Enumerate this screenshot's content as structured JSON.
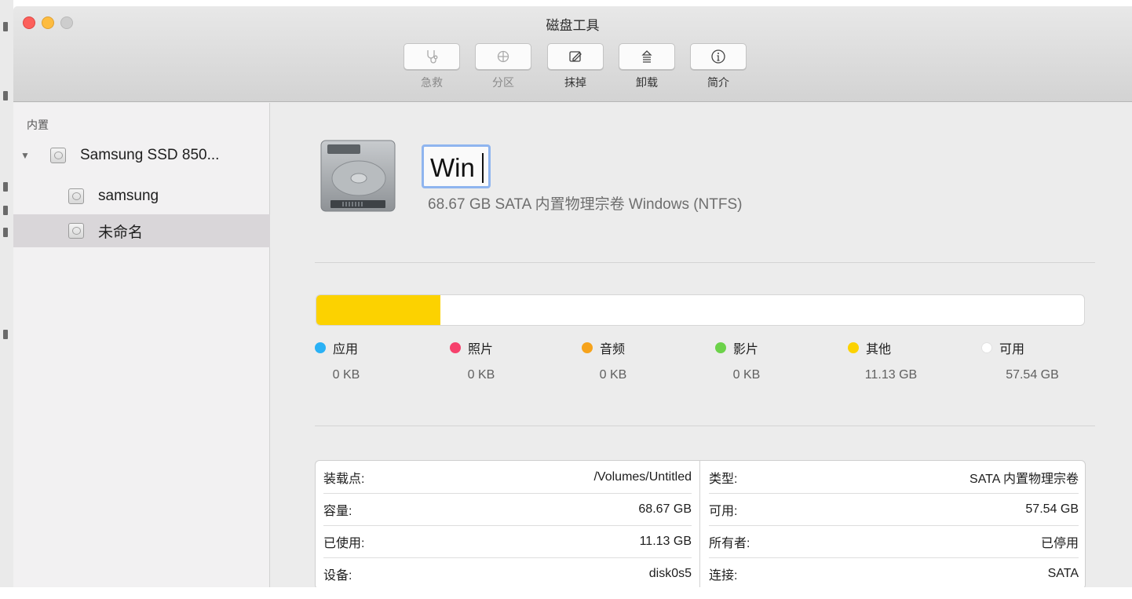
{
  "window": {
    "title": "磁盘工具"
  },
  "toolbar": {
    "buttons": [
      {
        "label": "急救",
        "icon": "stethoscope-icon",
        "enabled": false
      },
      {
        "label": "分区",
        "icon": "partition-icon",
        "enabled": false
      },
      {
        "label": "抹掉",
        "icon": "erase-icon",
        "enabled": true
      },
      {
        "label": "卸载",
        "icon": "eject-icon",
        "enabled": true
      },
      {
        "label": "简介",
        "icon": "info-icon",
        "enabled": true
      }
    ]
  },
  "sidebar": {
    "section": "内置",
    "items": [
      {
        "label": "Samsung SSD 850...",
        "icon": "drive-icon"
      },
      {
        "label": "samsung",
        "icon": "volume-icon"
      },
      {
        "label": "未命名",
        "icon": "volume-icon",
        "selected": true
      }
    ]
  },
  "volume": {
    "name": "Win",
    "description": "68.67 GB SATA 内置物理宗卷 Windows (NTFS)"
  },
  "usage": {
    "used_fraction": 0.162,
    "colors": {
      "other": "#fcd200"
    },
    "legend": [
      {
        "label": "应用",
        "value": "0 KB",
        "color": "#2ab1f5"
      },
      {
        "label": "照片",
        "value": "0 KB",
        "color": "#f6416c"
      },
      {
        "label": "音频",
        "value": "0 KB",
        "color": "#f6a31b"
      },
      {
        "label": "影片",
        "value": "0 KB",
        "color": "#6cd24a"
      },
      {
        "label": "其他",
        "value": "11.13 GB",
        "color": "#fcd200"
      },
      {
        "label": "可用",
        "value": "57.54 GB",
        "color": "#ffffff"
      }
    ]
  },
  "info": {
    "left": [
      {
        "key": "装载点:",
        "value": "/Volumes/Untitled"
      },
      {
        "key": "容量:",
        "value": "68.67 GB"
      },
      {
        "key": "已使用:",
        "value": "11.13 GB"
      },
      {
        "key": "设备:",
        "value": "disk0s5"
      }
    ],
    "right": [
      {
        "key": "类型:",
        "value": "SATA 内置物理宗卷"
      },
      {
        "key": "可用:",
        "value": "57.54 GB"
      },
      {
        "key": "所有者:",
        "value": "已停用"
      },
      {
        "key": "连接:",
        "value": "SATA"
      }
    ]
  }
}
